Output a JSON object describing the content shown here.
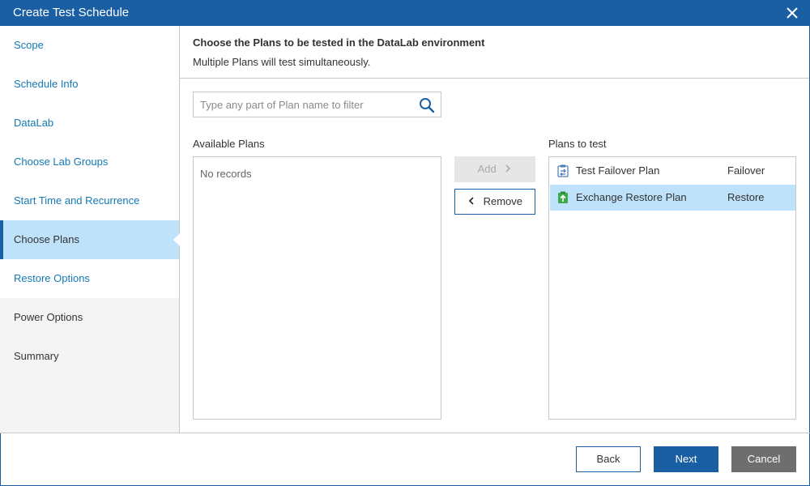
{
  "window": {
    "title": "Create Test Schedule"
  },
  "sidebar": {
    "items": [
      {
        "label": "Scope"
      },
      {
        "label": "Schedule Info"
      },
      {
        "label": "DataLab"
      },
      {
        "label": "Choose Lab Groups"
      },
      {
        "label": "Start Time and Recurrence"
      },
      {
        "label": "Choose Plans"
      },
      {
        "label": "Restore Options"
      },
      {
        "label": "Power Options"
      },
      {
        "label": "Summary"
      }
    ]
  },
  "header": {
    "title": "Choose the Plans to be tested in the DataLab environment",
    "subtitle": "Multiple Plans will test simultaneously."
  },
  "search": {
    "placeholder": "Type any part of Plan name to filter",
    "value": ""
  },
  "available": {
    "label": "Available Plans",
    "empty_text": "No records"
  },
  "actions": {
    "add_label": "Add",
    "remove_label": "Remove"
  },
  "plans_to_test": {
    "label": "Plans to test",
    "rows": [
      {
        "name": "Test Failover Plan",
        "type": "Failover",
        "icon": "failover-plan-icon"
      },
      {
        "name": "Exchange Restore Plan",
        "type": "Restore",
        "icon": "restore-plan-icon"
      }
    ]
  },
  "footer": {
    "back_label": "Back",
    "next_label": "Next",
    "cancel_label": "Cancel"
  },
  "colors": {
    "accent": "#1a5ea3",
    "selected": "#bfe2fb",
    "link": "#1478b4"
  }
}
